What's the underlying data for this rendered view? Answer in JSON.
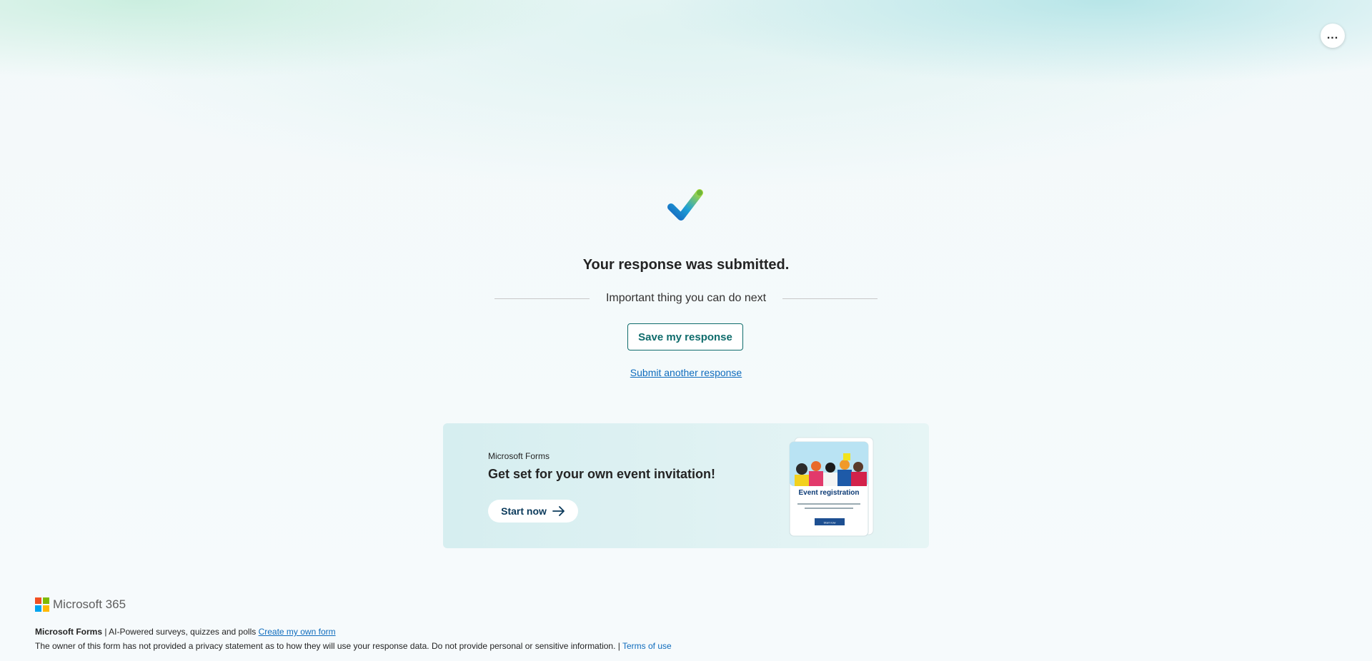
{
  "header": {
    "more_options_label": "..."
  },
  "confirmation": {
    "title": "Your response was submitted.",
    "divider_text": "Important thing you can do next",
    "save_button_label": "Save my response",
    "submit_another_label": "Submit another response"
  },
  "promo": {
    "brand": "Microsoft Forms",
    "heading": "Get set for your own event invitation!",
    "start_button_label": "Start now",
    "image": {
      "card_title": "Event registration",
      "card_body": "Invite guests, collect RSVPs, and customize to match your party theme.",
      "card_button": "Start now"
    }
  },
  "footer": {
    "logo_text": "Microsoft 365",
    "product_name": "Microsoft Forms",
    "tagline": " | AI-Powered surveys, quizzes and polls ",
    "create_link": "Create my own form",
    "privacy_notice": "The owner of this form has not provided a privacy statement as to how they will use your response data. Do not provide personal or sensitive information. | ",
    "terms_link": "Terms of use"
  },
  "colors": {
    "accent_teal": "#0f6c6c",
    "link_blue": "#0f6cbd",
    "promo_background": "#d6eef0"
  }
}
